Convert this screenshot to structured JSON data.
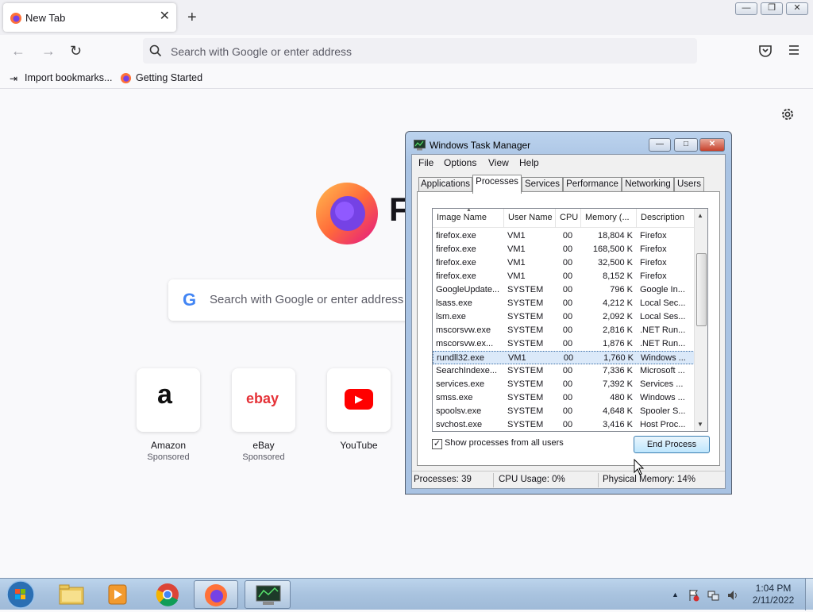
{
  "browser": {
    "tab": {
      "title": "New Tab",
      "close": "✕"
    },
    "new_tab": "+",
    "urlbar": {
      "placeholder": "Search with Google or enter address"
    },
    "bookmarks": [
      {
        "label": "Import bookmarks..."
      },
      {
        "label": "Getting Started"
      }
    ]
  },
  "newtab": {
    "search_placeholder": "Search with Google or enter address",
    "google_letter": "G",
    "wordmark": "F",
    "shortcuts": [
      {
        "label": "Amazon",
        "sub": "Sponsored",
        "glyph": "a"
      },
      {
        "label": "eBay",
        "sub": "Sponsored",
        "glyph": "ebay"
      },
      {
        "label": "YouTube",
        "sub": "",
        "glyph": "▶"
      }
    ]
  },
  "taskmanager": {
    "title": "Windows Task Manager",
    "menu": [
      "File",
      "Options",
      "View",
      "Help"
    ],
    "tabs": [
      "Applications",
      "Processes",
      "Services",
      "Performance",
      "Networking",
      "Users"
    ],
    "active_tab": "Processes",
    "columns": [
      "Image Name",
      "User Name",
      "CPU",
      "Memory (...",
      "Description"
    ],
    "rows": [
      [
        "firefox.exe",
        "VM1",
        "00",
        "18,804 K",
        "Firefox"
      ],
      [
        "firefox.exe",
        "VM1",
        "00",
        "168,500 K",
        "Firefox"
      ],
      [
        "firefox.exe",
        "VM1",
        "00",
        "32,500 K",
        "Firefox"
      ],
      [
        "firefox.exe",
        "VM1",
        "00",
        "8,152 K",
        "Firefox"
      ],
      [
        "GoogleUpdate...",
        "SYSTEM",
        "00",
        "796 K",
        "Google In..."
      ],
      [
        "lsass.exe",
        "SYSTEM",
        "00",
        "4,212 K",
        "Local Sec..."
      ],
      [
        "lsm.exe",
        "SYSTEM",
        "00",
        "2,092 K",
        "Local Ses..."
      ],
      [
        "mscorsvw.exe",
        "SYSTEM",
        "00",
        "2,816 K",
        ".NET Run..."
      ],
      [
        "mscorsvw.ex...",
        "SYSTEM",
        "00",
        "1,876 K",
        ".NET Run..."
      ],
      [
        "rundll32.exe",
        "VM1",
        "00",
        "1,760 K",
        "Windows ..."
      ],
      [
        "SearchIndexe...",
        "SYSTEM",
        "00",
        "7,336 K",
        "Microsoft ..."
      ],
      [
        "services.exe",
        "SYSTEM",
        "00",
        "7,392 K",
        "Services ..."
      ],
      [
        "smss.exe",
        "SYSTEM",
        "00",
        "480 K",
        "Windows ..."
      ],
      [
        "spoolsv.exe",
        "SYSTEM",
        "00",
        "4,648 K",
        "Spooler S..."
      ],
      [
        "svchost.exe",
        "SYSTEM",
        "00",
        "3,416 K",
        "Host Proc..."
      ]
    ],
    "selected_row": 9,
    "show_all_label": "Show processes from all users",
    "show_all_checked": true,
    "end_process": "End Process",
    "status": {
      "processes": "Processes: 39",
      "cpu": "CPU Usage: 0%",
      "memory": "Physical Memory: 14%"
    }
  },
  "taskbar": {
    "clock_time": "1:04 PM",
    "clock_date": "2/11/2022"
  }
}
